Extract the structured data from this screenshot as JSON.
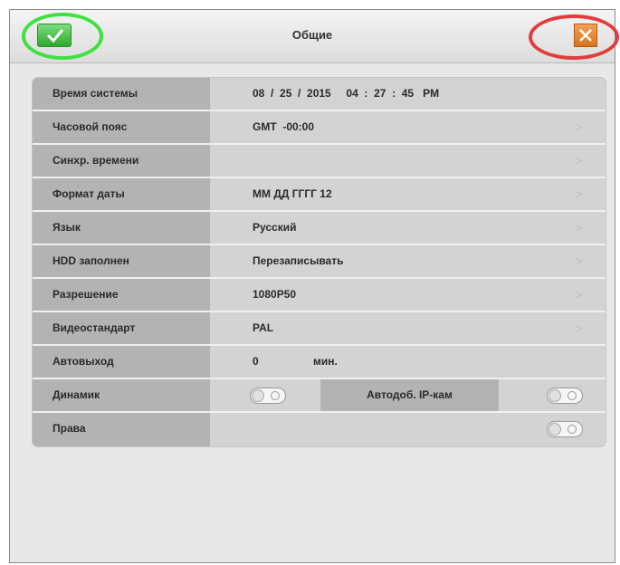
{
  "header": {
    "title": "Общие",
    "ok_icon": "checkmark-icon",
    "close_icon": "close-icon",
    "ok_color": "#2ea82e",
    "close_color": "#e07c24"
  },
  "rows": {
    "system_time": {
      "label": "Время системы",
      "value": "08  /  25  /  2015     04  :  27  :  45   PM"
    },
    "timezone": {
      "label": "Часовой пояс",
      "value": "GMT  -00:00"
    },
    "time_sync": {
      "label": "Синхр. времени",
      "value": ""
    },
    "date_format": {
      "label": "Формат даты",
      "value": "ММ ДД ГГГГ 12"
    },
    "language": {
      "label": "Язык",
      "value": "Русский"
    },
    "hdd_full": {
      "label": "HDD заполнен",
      "value": "Перезаписывать"
    },
    "resolution": {
      "label": "Разрешение",
      "value": "1080P50"
    },
    "video_standard": {
      "label": "Видеостандарт",
      "value": "PAL"
    },
    "auto_logout": {
      "label": "Автовыход",
      "value": "0",
      "unit": "мин."
    },
    "speaker": {
      "label": "Динамик",
      "toggle": "off"
    },
    "auto_add_ipcam": {
      "label": "Автодоб. IP-кам",
      "toggle": "off"
    },
    "rights": {
      "label": "Права",
      "toggle": "off"
    }
  },
  "chevron": ">"
}
